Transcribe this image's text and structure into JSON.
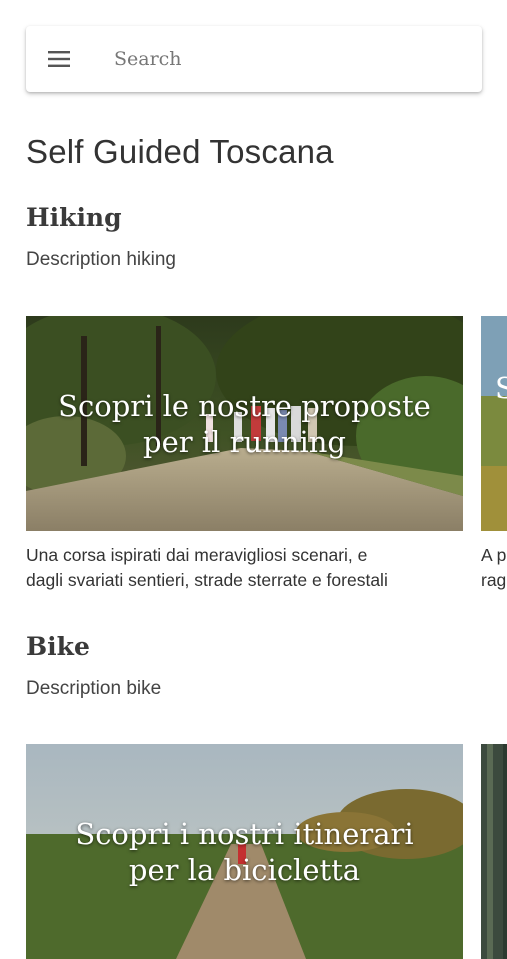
{
  "search": {
    "placeholder": "Search",
    "menu_icon": "hamburger-menu-icon"
  },
  "page": {
    "title": "Self Guided Toscana"
  },
  "sections": [
    {
      "title": "Hiking",
      "description": "Description hiking",
      "cards": [
        {
          "overlay": "Scopri le nostre proposte per il running",
          "description_lines": [
            "Una corsa ispirati dai meravigliosi scenari, e",
            "dagli svariati sentieri, strade sterrate e forestali"
          ]
        }
      ],
      "peek": {
        "description_lines": [
          "A p",
          "rag"
        ]
      }
    },
    {
      "title": "Bike",
      "description": "Description bike",
      "cards": [
        {
          "overlay": "Scopri i nostri itinerari per la bicicletta"
        }
      ]
    }
  ]
}
